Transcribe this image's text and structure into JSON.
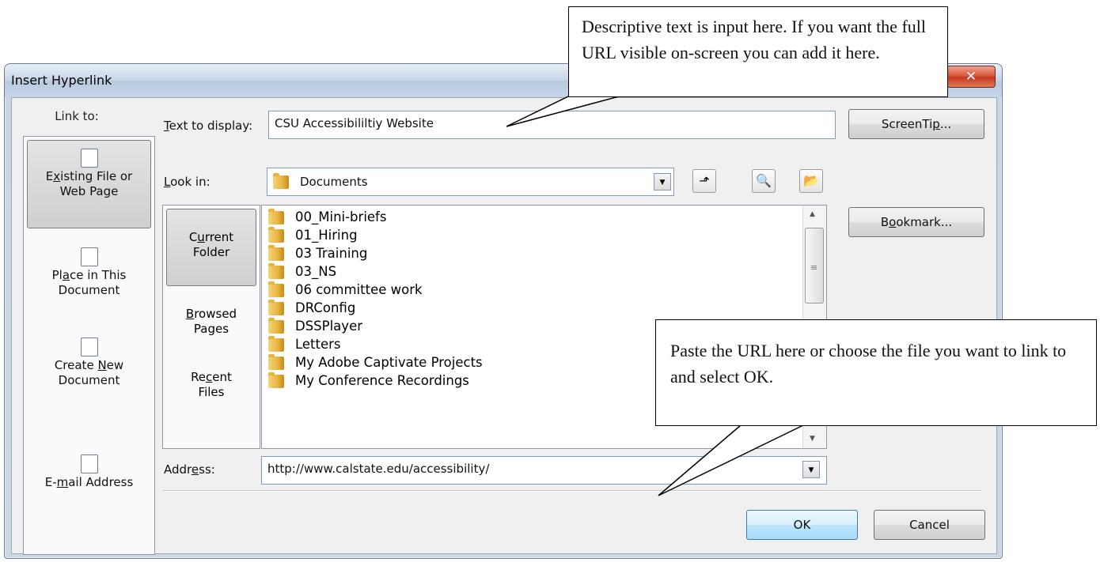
{
  "window": {
    "title": "Insert Hyperlink",
    "close_glyph": "✕"
  },
  "link_to": {
    "label": "Link to:",
    "items": [
      {
        "line1": "Existing File or",
        "line2": "Web Page",
        "icon": "globe-document-icon"
      },
      {
        "line1": "Place in This",
        "line2": "Document",
        "icon": "document-bookmark-icon"
      },
      {
        "line1": "Create New",
        "line2": "Document",
        "icon": "new-document-icon"
      },
      {
        "line1": "E-mail Address",
        "line2": "",
        "icon": "email-icon"
      }
    ]
  },
  "text_to_display": {
    "label": "Text to display:",
    "value": "CSU Accessibililtiy Website"
  },
  "screentip": "ScreenTip...",
  "look_in": {
    "label": "Look in:",
    "value": "Documents"
  },
  "bookmark": "Bookmark...",
  "nav": [
    {
      "line1": "Current",
      "line2": "Folder"
    },
    {
      "line1": "Browsed",
      "line2": "Pages"
    },
    {
      "line1": "Recent",
      "line2": "Files"
    }
  ],
  "files": [
    "00_Mini-briefs",
    "01_Hiring",
    "03 Training",
    "03_NS",
    "06 committee work",
    "DRConfig",
    "DSSPlayer",
    "Letters",
    "My Adobe Captivate Projects",
    "My Conference Recordings"
  ],
  "address": {
    "label": "Address:",
    "value": "http://www.calstate.edu/accessibility/"
  },
  "ok": "OK",
  "cancel": "Cancel",
  "callouts": {
    "top": "Descriptive text is input here. If you want the full URL visible on-screen you can add it here.",
    "bottom": "Paste the URL here or choose the file you want to link to and select OK."
  }
}
